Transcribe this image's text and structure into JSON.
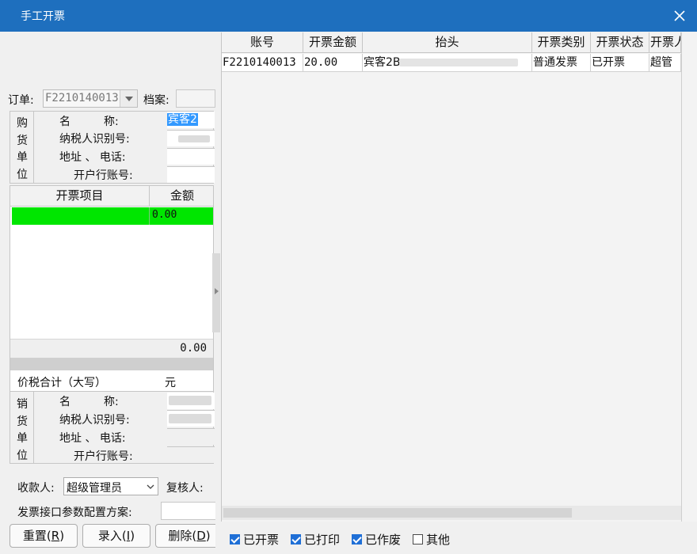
{
  "window": {
    "title": "手工开票"
  },
  "order": {
    "label": "订单:",
    "value": "F2210140013",
    "archive_label": "档案:",
    "archive_value": ""
  },
  "buyer": {
    "vertical_label": [
      "购",
      "货",
      "单",
      "位"
    ],
    "fields": [
      {
        "label": "名　　　称:",
        "value": "宾客2"
      },
      {
        "label": "纳税人识别号:",
        "value": ""
      },
      {
        "label": "地址 、 电话:",
        "value": ""
      },
      {
        "label": "开户行账号:",
        "value": ""
      }
    ]
  },
  "items": {
    "columns": [
      "开票项目",
      "金额"
    ],
    "rows": [
      {
        "name": "",
        "amount": "0.00"
      }
    ],
    "total": "0.00"
  },
  "tax_total": {
    "label": "价税合计（大写）",
    "value": "元"
  },
  "seller": {
    "vertical_label": [
      "销",
      "货",
      "单",
      "位"
    ],
    "fields": [
      {
        "label": "名　　　称:",
        "value": ""
      },
      {
        "label": "纳税人识别号:",
        "value": ""
      },
      {
        "label": "地址 、 电话:",
        "value": ""
      },
      {
        "label": "开户行账号:",
        "value": ""
      }
    ]
  },
  "payee": {
    "label": "收款人:",
    "value": "超级管理员"
  },
  "reviewer": {
    "label": "复核人:",
    "value": ""
  },
  "config": {
    "label": "发票接口参数配置方案:",
    "value": ""
  },
  "buttons": {
    "reset": "重置",
    "reset_key": "R",
    "enter": "录入",
    "enter_key": "I",
    "delete": "删除",
    "delete_key": "D"
  },
  "grid": {
    "columns": [
      "账号",
      "开票金额",
      "抬头",
      "开票类别",
      "开票状态",
      "开票人"
    ],
    "rows": [
      {
        "account": "F2210140013",
        "amount": "20.00",
        "title": "宾客2B",
        "category": "普通发票",
        "status": "已开票",
        "issuer": "超管"
      }
    ]
  },
  "filters": [
    {
      "label": "已开票",
      "checked": true
    },
    {
      "label": "已打印",
      "checked": true
    },
    {
      "label": "已作废",
      "checked": true
    },
    {
      "label": "其他",
      "checked": false
    }
  ],
  "colors": {
    "titlebar": "#1e6fbe",
    "highlight_row": "#00e600",
    "selection": "#3399ff"
  }
}
